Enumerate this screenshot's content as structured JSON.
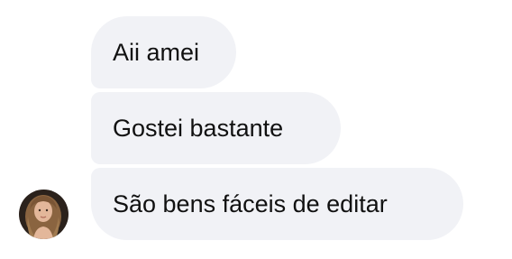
{
  "thread": {
    "messages": [
      {
        "text": "Aii amei"
      },
      {
        "text": "Gostei bastante"
      },
      {
        "text": "São bens fáceis de editar"
      }
    ],
    "avatar": {
      "icon": "user-avatar-photo",
      "bg_color": "#2b221c",
      "hair_color": "#8a6440",
      "skin_color": "#e3b79a"
    }
  },
  "colors": {
    "bubble_bg": "#f1f2f6",
    "text": "#111111",
    "page_bg": "#ffffff"
  }
}
